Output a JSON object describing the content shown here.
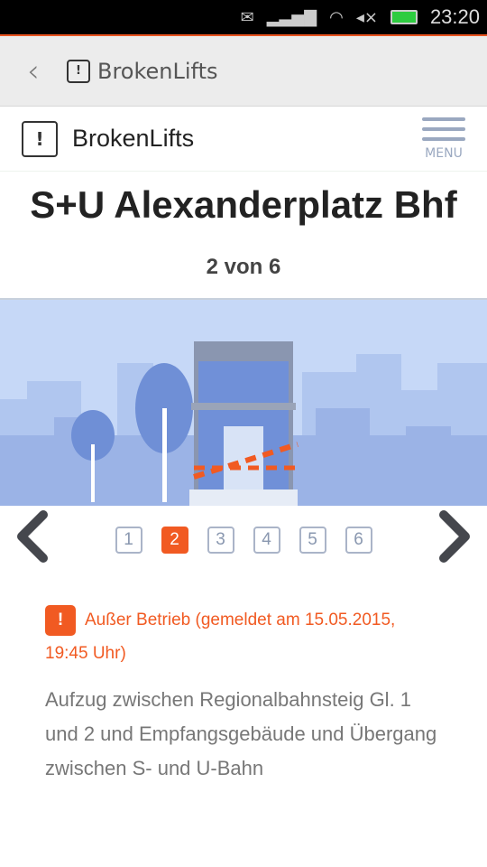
{
  "status": {
    "time": "23:20",
    "icons": [
      "mail-icon",
      "signal-icon",
      "wifi-icon",
      "mute-icon",
      "battery-icon"
    ]
  },
  "appbar": {
    "title": "BrokenLifts"
  },
  "site": {
    "name": "BrokenLifts",
    "menu_label": "MENU"
  },
  "station": {
    "name": "S+U Alexanderplatz Bhf",
    "position": "2 von 6"
  },
  "pager": {
    "pages": [
      "1",
      "2",
      "3",
      "4",
      "5",
      "6"
    ],
    "current": 2
  },
  "notice": {
    "status": "Außer Betrieb (gemeldet am 15.05.2015, 19:45 Uhr)",
    "icon_text": "!"
  },
  "description": "Aufzug zwischen Regionalbahnsteig Gl. 1 und 2 und Empfangsgebäude und Übergang zwischen S- und U-Bahn",
  "colors": {
    "accent": "#f15a22",
    "muted": "#9aa8c0"
  }
}
